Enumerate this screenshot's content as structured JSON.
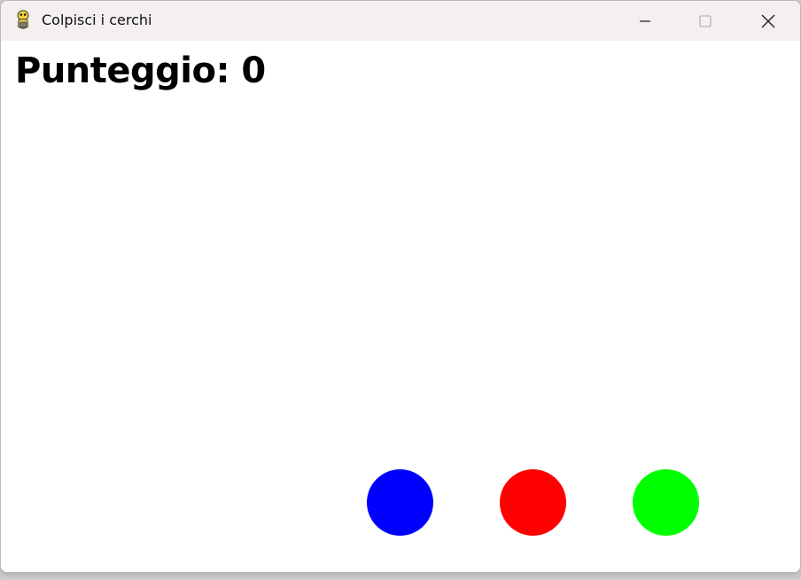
{
  "window": {
    "title": "Colpisci i cerchi",
    "icon": "pygame-snake-icon",
    "controls": {
      "minimize_icon": "minimize-icon",
      "maximize_icon": "maximize-icon",
      "close_icon": "close-icon"
    }
  },
  "game": {
    "score_text": "Punteggio: 0",
    "circles": [
      {
        "name": "blue-circle",
        "color": "#0000ff"
      },
      {
        "name": "red-circle",
        "color": "#ff0000"
      },
      {
        "name": "green-circle",
        "color": "#00ff00"
      }
    ]
  }
}
